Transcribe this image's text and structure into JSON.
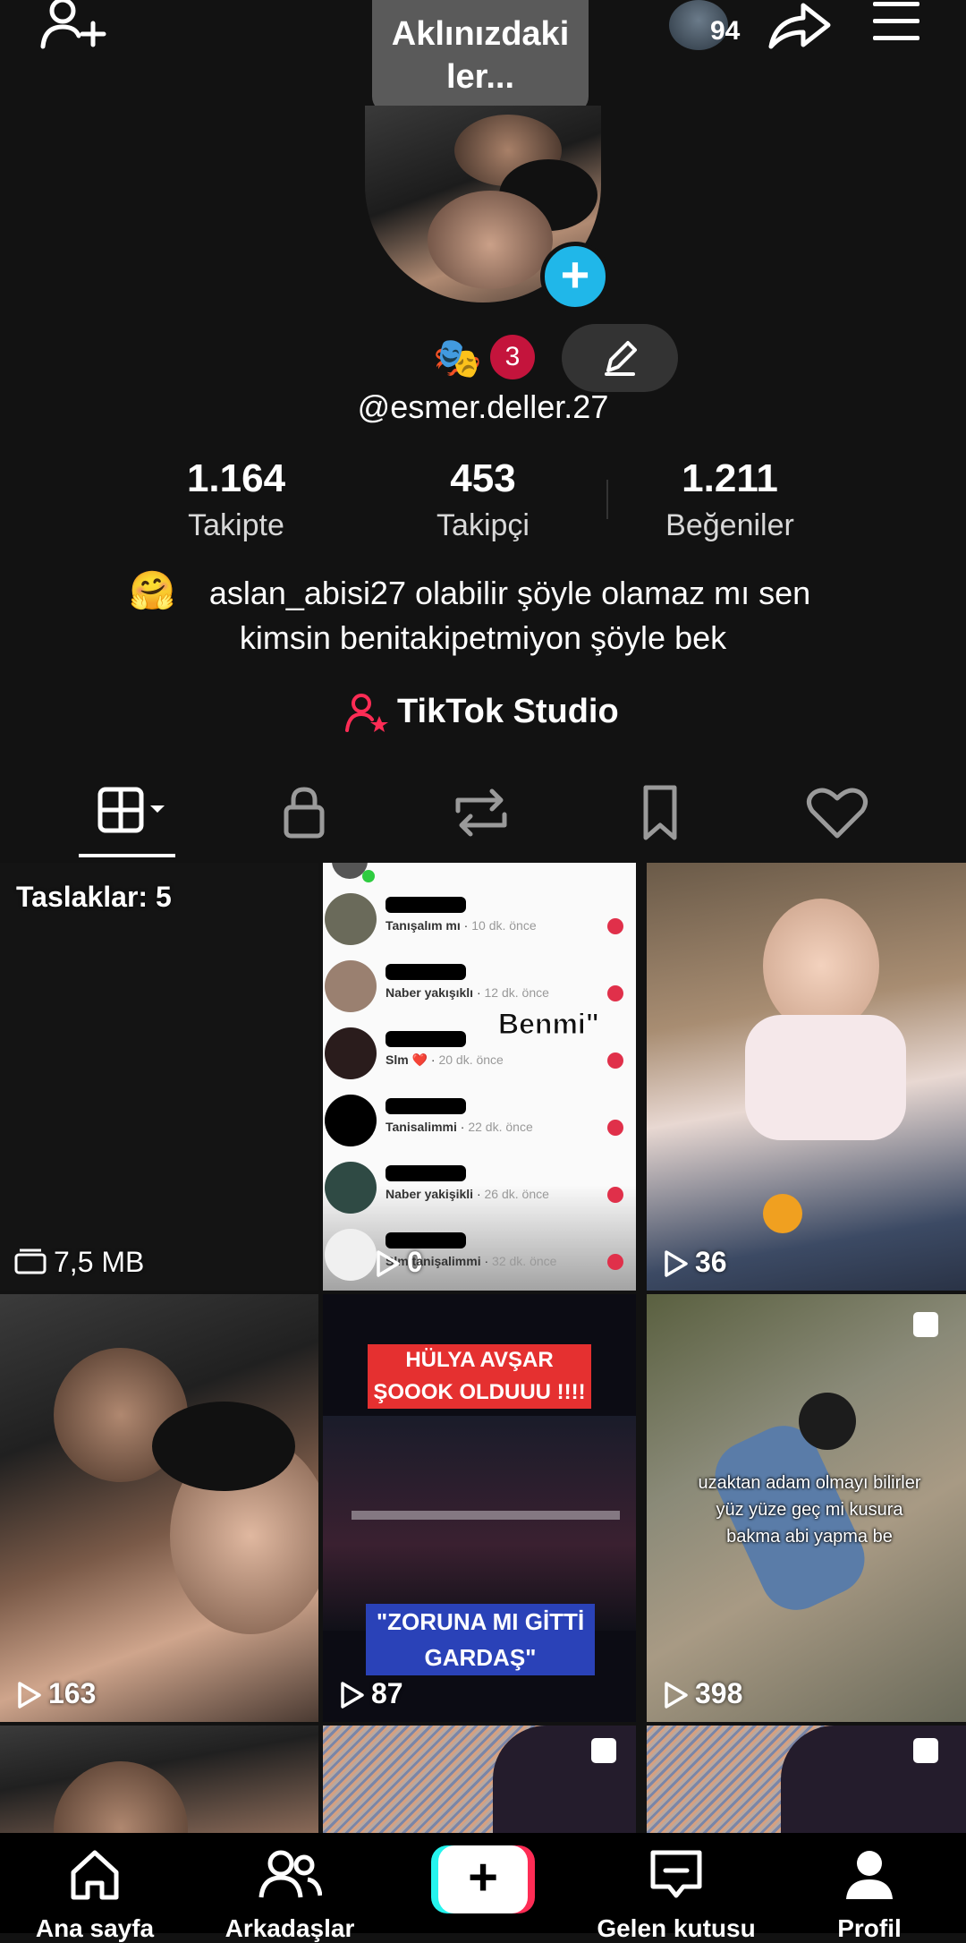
{
  "header": {
    "bubble_line1": "Aklınızdaki",
    "bubble_line2": "ler...",
    "story_count": "94"
  },
  "profile": {
    "badge_count": "3",
    "username": "@esmer.deller.27",
    "stats": [
      {
        "value": "1.164",
        "label": "Takipte"
      },
      {
        "value": "453",
        "label": "Takipçi"
      },
      {
        "value": "1.211",
        "label": "Beğeniler"
      }
    ],
    "bio_emoji": "🤗",
    "bio_line1": "aslan_abisi27 olabilir şöyle olamaz mı sen",
    "bio_line2": "kimsin benitakipetmiyon şöyle bek",
    "studio_label": "TikTok Studio"
  },
  "grid": {
    "drafts_label": "Taslaklar: 5",
    "drafts_size": "7,5 MB",
    "videos": [
      {
        "views": "0",
        "overlay": "Benmi\""
      },
      {
        "views": "36"
      },
      {
        "views": "163"
      },
      {
        "views": "87",
        "overlay_top": "HÜLYA AVŞAR\nŞOOOK OLDUUU !!!!",
        "overlay_bottom": "\"ZORUNA MI GİTTİ\nGARDAŞ\""
      },
      {
        "views": "398",
        "overlay": "uzaktan adam olmayı bilirler\nyüz yüze geç mi kusura\nbakma abi yapma be"
      }
    ],
    "notif_rows": [
      {
        "name": "Tanışalım mı",
        "time": "10 dk. önce"
      },
      {
        "name": "Naber yakışıklı",
        "time": "12 dk. önce"
      },
      {
        "name": "Slm ❤️",
        "time": "20 dk. önce"
      },
      {
        "name": "Tanisalimmi",
        "time": "22 dk. önce"
      },
      {
        "name": "Naber yakişikli",
        "time": "26 dk. önce"
      },
      {
        "name": "Slm tanişalimmi",
        "time": "32 dk. önce"
      }
    ]
  },
  "bottom_nav": {
    "home": "Ana sayfa",
    "friends": "Arkadaşlar",
    "inbox": "Gelen kutusu",
    "profile": "Profil"
  },
  "colors": {
    "background": "#121212",
    "accent_blue": "#20b7e9",
    "badge_red": "#c4143c",
    "studio_red": "#fe2c55"
  }
}
